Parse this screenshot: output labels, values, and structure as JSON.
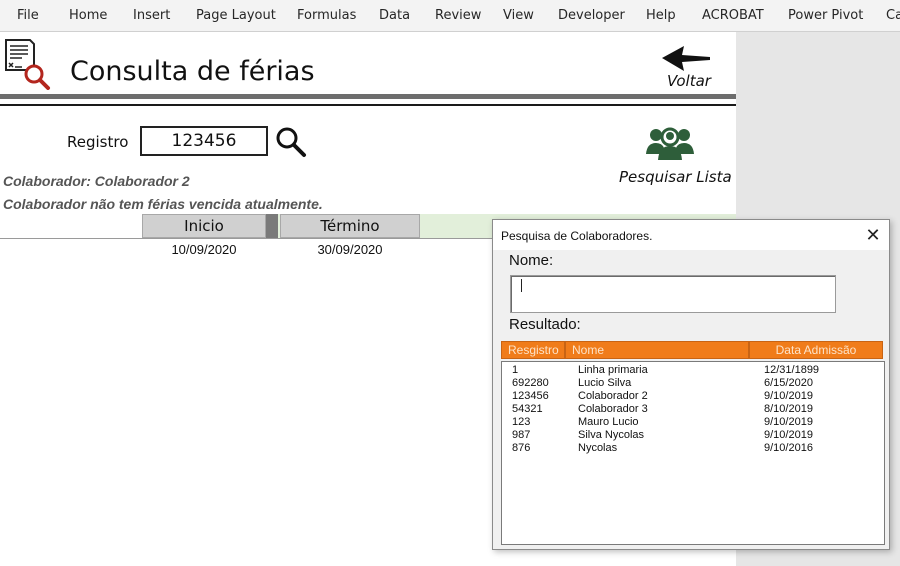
{
  "ribbon": {
    "tabs": [
      "File",
      "Home",
      "Insert",
      "Page Layout",
      "Formulas",
      "Data",
      "Review",
      "View",
      "Developer",
      "Help",
      "ACROBAT",
      "Power Pivot",
      "Ca"
    ]
  },
  "header": {
    "title": "Consulta de férias",
    "back_label": "Voltar"
  },
  "search": {
    "registro_label": "Registro",
    "registro_value": "123456",
    "list_search_label": "Pesquisar Lista"
  },
  "status": {
    "colaborador": "Colaborador: Colaborador 2",
    "message": "Colaborador não tem férias vencida atualmente."
  },
  "vacation": {
    "col_start": "Inicio",
    "col_end": "Término",
    "start_date": "10/09/2020",
    "end_date": "30/09/2020"
  },
  "dialog": {
    "title": "Pesquisa de Colaboradores.",
    "close_symbol": "✕",
    "nome_label": "Nome:",
    "nome_value": "",
    "result_label": "Resultado:",
    "columns": [
      "Resgistro",
      "Nome",
      "Data Admissão"
    ],
    "rows": [
      [
        "1",
        "Linha primaria",
        "12/31/1899"
      ],
      [
        "692280",
        "Lucio Silva",
        "6/15/2020"
      ],
      [
        "123456",
        "Colaborador 2",
        "9/10/2019"
      ],
      [
        "54321",
        "Colaborador 3",
        "8/10/2019"
      ],
      [
        "123",
        "Mauro Lucio",
        "9/10/2019"
      ],
      [
        "987",
        "Silva Nycolas",
        "9/10/2019"
      ],
      [
        "876",
        "Nycolas",
        "9/10/2016"
      ]
    ]
  },
  "colors": {
    "accent_orange": "#f07c1a",
    "header_green": "#e2efda",
    "icon_green": "#2e5e3a",
    "magnifier_red": "#b3261e"
  }
}
